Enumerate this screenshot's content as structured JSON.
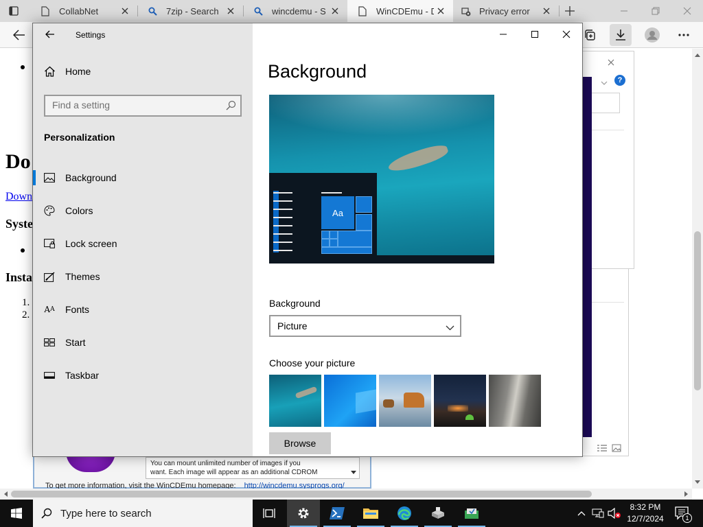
{
  "browser": {
    "tabs": [
      {
        "title": "CollabNet",
        "icon": "page-icon"
      },
      {
        "title": "7zip - Search",
        "icon": "search-icon"
      },
      {
        "title": "wincdemu - Sea",
        "icon": "search-icon"
      },
      {
        "title": "WinCDEmu - Do",
        "icon": "page-icon"
      },
      {
        "title": "Privacy error",
        "icon": "privacy-icon"
      }
    ],
    "active_tab_index": 3
  },
  "webpage": {
    "heading": "Do",
    "link": "Down",
    "section1": "Syste",
    "section2": "Insta",
    "ol_items": [
      "1.",
      "2."
    ]
  },
  "installer": {
    "text_line1": "You can mount unlimited number of images if you",
    "text_line2": "want. Each image will appear as an additional CDROM",
    "info_prefix": "To get more information, visit the WinCDEmu homepage:",
    "info_link": "http://wincdemu.sysprogs.org/"
  },
  "settings": {
    "window_title": "Settings",
    "home_label": "Home",
    "search_placeholder": "Find a setting",
    "section_heading": "Personalization",
    "nav_items": [
      {
        "label": "Background",
        "icon": "picture-icon",
        "selected": true
      },
      {
        "label": "Colors",
        "icon": "palette-icon",
        "selected": false
      },
      {
        "label": "Lock screen",
        "icon": "lock-screen-icon",
        "selected": false
      },
      {
        "label": "Themes",
        "icon": "brush-icon",
        "selected": false
      },
      {
        "label": "Fonts",
        "icon": "fonts-icon",
        "selected": false
      },
      {
        "label": "Start",
        "icon": "start-icon",
        "selected": false
      },
      {
        "label": "Taskbar",
        "icon": "taskbar-icon",
        "selected": false
      }
    ],
    "page_title": "Background",
    "preview_tile_text": "Aa",
    "background_label": "Background",
    "background_value": "Picture",
    "choose_label": "Choose your picture",
    "browse_label": "Browse",
    "accent_color": "#0078d7"
  },
  "taskbar": {
    "search_placeholder": "Type here to search",
    "time": "8:32 PM",
    "date": "12/7/2024",
    "notification_count": "1"
  }
}
